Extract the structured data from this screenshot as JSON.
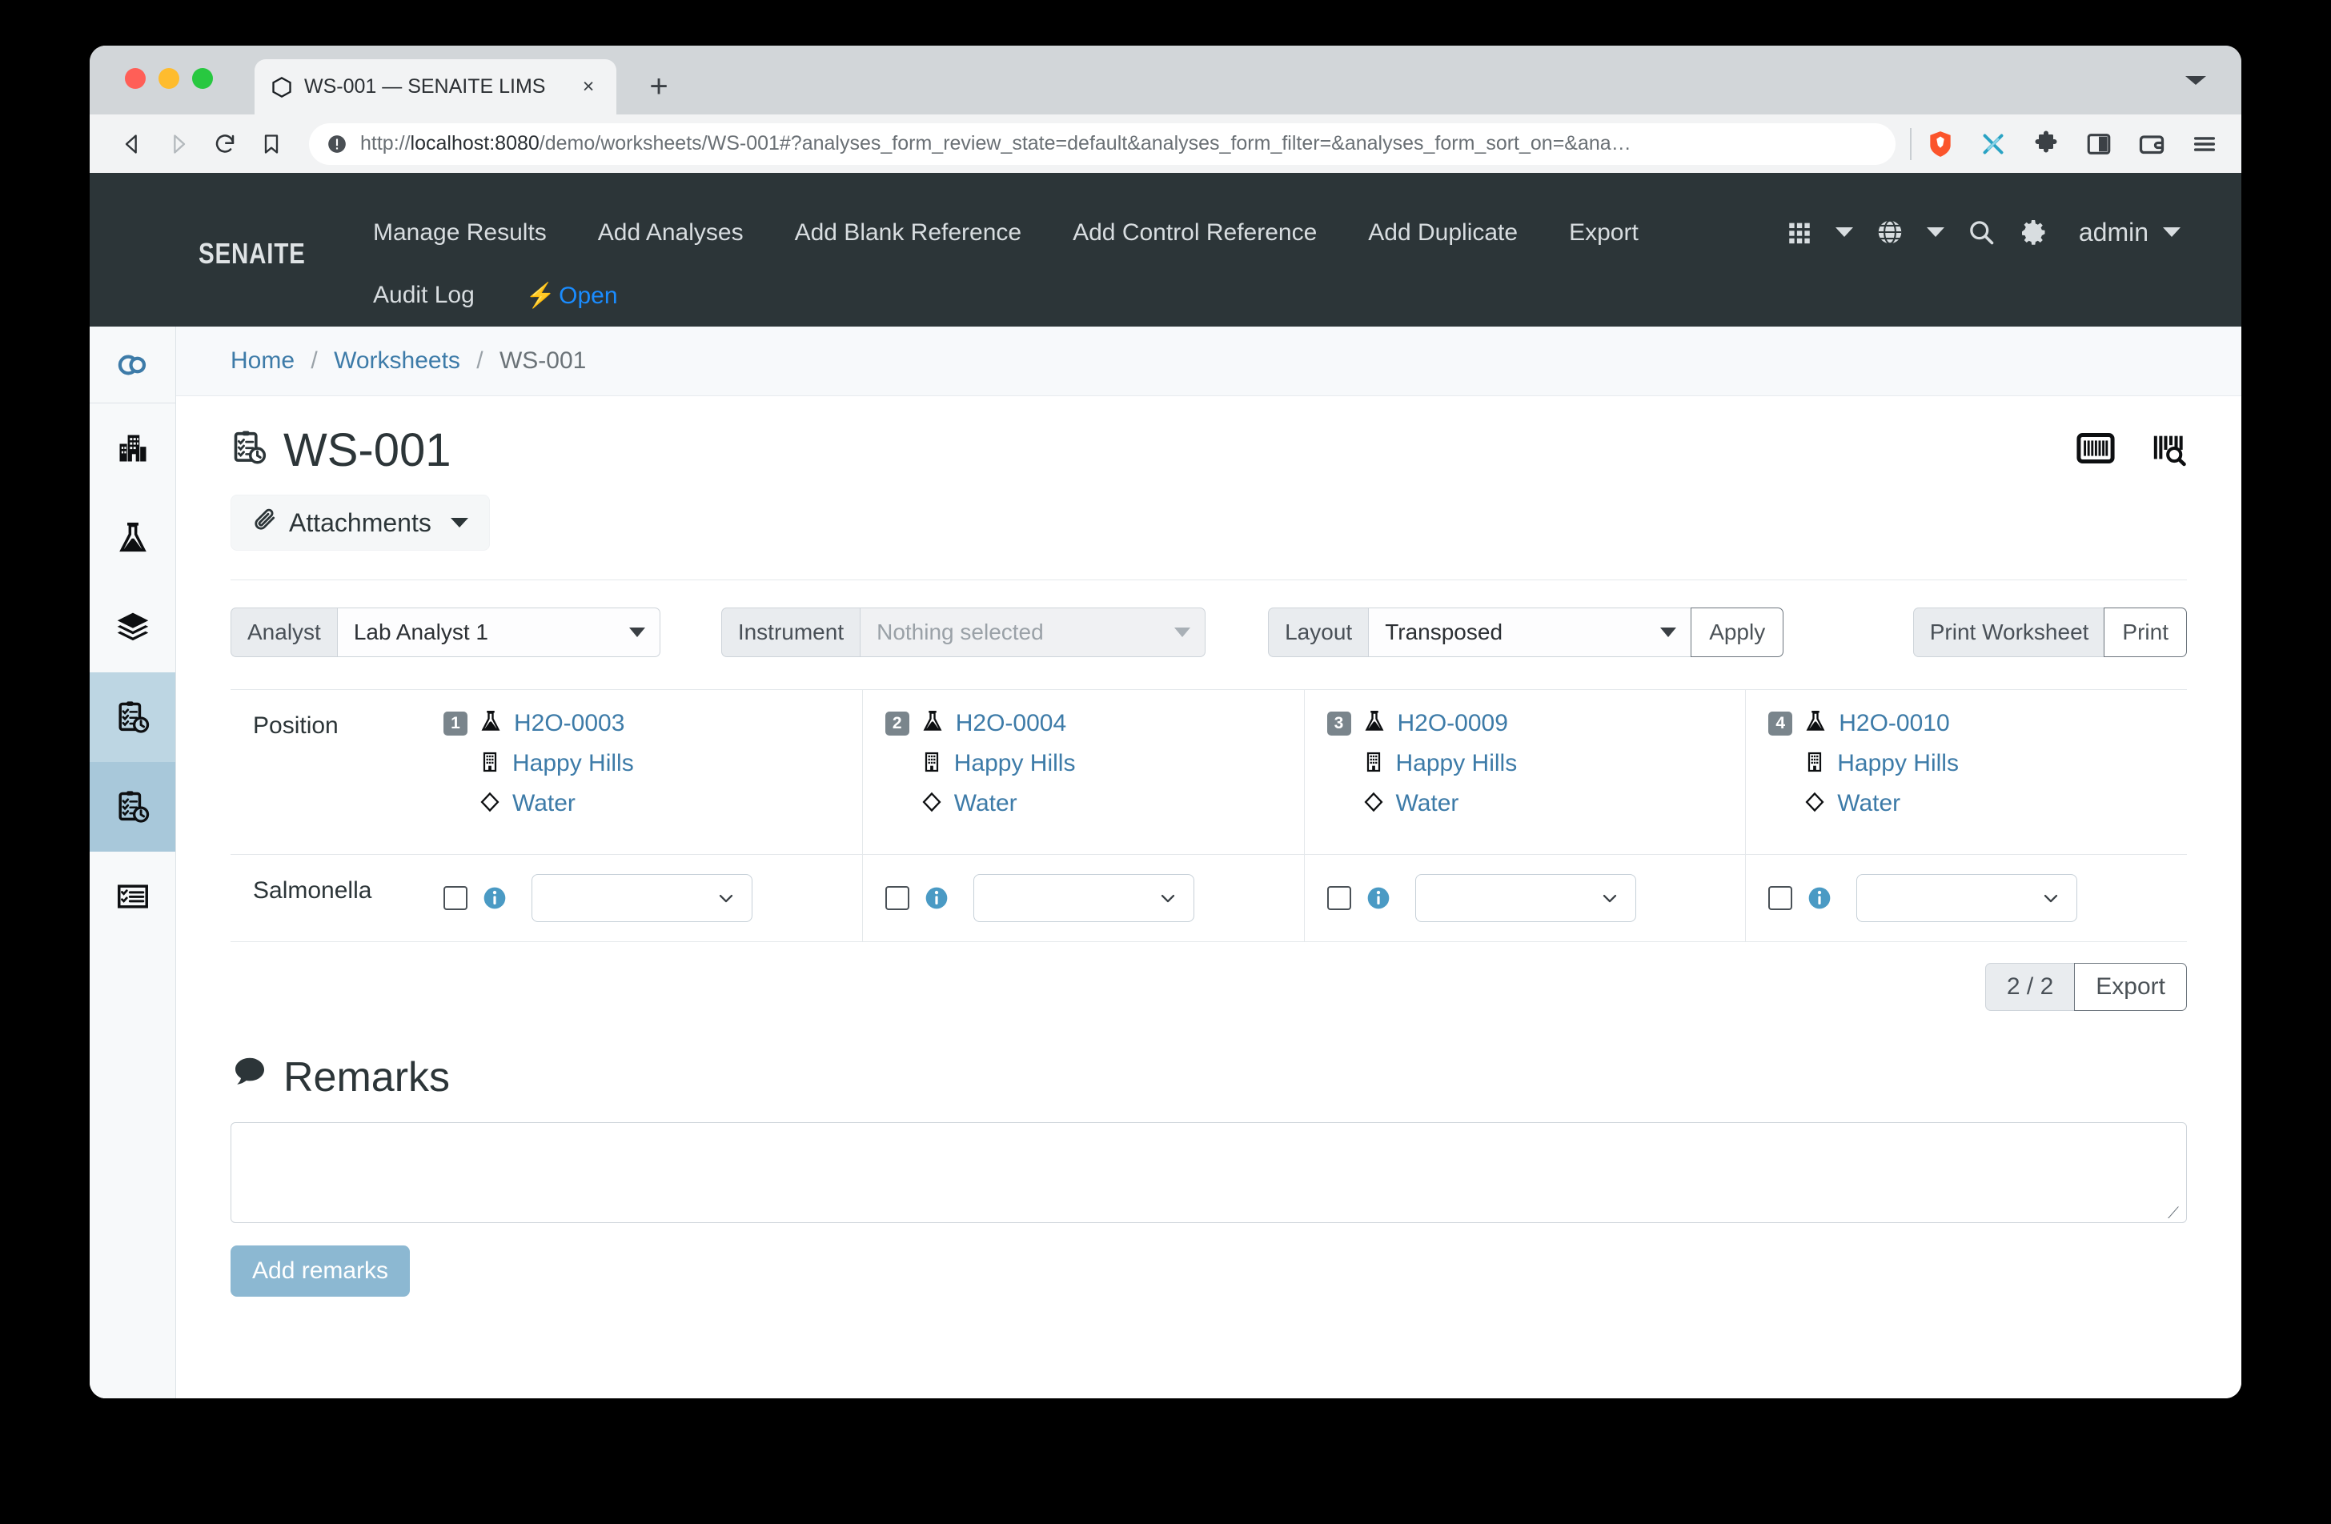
{
  "browser": {
    "tab_title": "WS-001 — SENAITE LIMS",
    "tab_favicon": "hexagon-icon",
    "close_tab": "×",
    "new_tab": "+",
    "url_prefix": "http://",
    "url_host": "localhost:8080",
    "url_rest": "/demo/worksheets/WS-001#?analyses_form_review_state=default&analyses_form_filter=&analyses_form_sort_on=&ana…",
    "back": "back-icon",
    "forward": "forward-icon",
    "reload": "reload-icon",
    "bookmark": "bookmark-icon",
    "security": "info-shield-icon",
    "toolbar_icons": [
      "brave-lion-icon",
      "braveshields-icon",
      "extensions-puzzle-icon",
      "sidebar-panel-icon",
      "wallet-icon",
      "menu-hamburger-icon"
    ]
  },
  "navbar": {
    "brand": "SENAITE",
    "links": [
      {
        "label": "Manage Results",
        "accent": false
      },
      {
        "label": "Add Analyses",
        "accent": false
      },
      {
        "label": "Add Blank Reference",
        "accent": false
      },
      {
        "label": "Add Control Reference",
        "accent": false
      },
      {
        "label": "Add Duplicate",
        "accent": false
      },
      {
        "label": "Export",
        "accent": false
      },
      {
        "label": "Audit Log",
        "accent": false
      },
      {
        "label": "Open",
        "accent": true
      }
    ],
    "user": "admin",
    "accent_color": "#1a8cff",
    "background": "#2c3538"
  },
  "sidebar": {
    "items": [
      {
        "name": "sidebar-toggle",
        "icon": "toggle-switch-icon",
        "state": "toggle"
      },
      {
        "name": "sidebar-item-clients",
        "icon": "building-icon",
        "state": "normal"
      },
      {
        "name": "sidebar-item-samples",
        "icon": "flask-icon",
        "state": "normal"
      },
      {
        "name": "sidebar-item-batches",
        "icon": "layers-icon",
        "state": "normal"
      },
      {
        "name": "sidebar-item-worksheets",
        "icon": "clipboard-clock-icon",
        "state": "selected-light"
      },
      {
        "name": "sidebar-item-worksheet-current",
        "icon": "clipboard-clock-icon",
        "state": "selected-dark"
      },
      {
        "name": "sidebar-item-methods",
        "icon": "checklist-icon",
        "state": "normal"
      }
    ]
  },
  "breadcrumb": {
    "home": "Home",
    "worksheets": "Worksheets",
    "current": "WS-001",
    "separator": "/"
  },
  "page": {
    "title": "WS-001",
    "title_icon": "clipboard-clock-icon",
    "attachments_label": "Attachments",
    "attachments_icon": "paperclip-icon",
    "barcode_icon": "barcode-icon",
    "barcode_scan_icon": "barcode-search-icon"
  },
  "filters": {
    "analyst_label": "Analyst",
    "analyst_value": "Lab Analyst 1",
    "instrument_label": "Instrument",
    "instrument_placeholder": "Nothing selected",
    "layout_label": "Layout",
    "layout_value": "Transposed",
    "apply_label": "Apply",
    "print_worksheet_label": "Print Worksheet",
    "print_label": "Print"
  },
  "worksheet": {
    "position_row_label": "Position",
    "positions": [
      {
        "pos": "1",
        "sample": "H2O-0003",
        "client": "Happy Hills",
        "sample_type": "Water"
      },
      {
        "pos": "2",
        "sample": "H2O-0004",
        "client": "Happy Hills",
        "sample_type": "Water"
      },
      {
        "pos": "3",
        "sample": "H2O-0009",
        "client": "Happy Hills",
        "sample_type": "Water"
      },
      {
        "pos": "4",
        "sample": "H2O-0010",
        "client": "Happy Hills",
        "sample_type": "Water"
      }
    ],
    "analyses": [
      {
        "name": "Salmonella",
        "cells": [
          {
            "checked": false,
            "result": ""
          },
          {
            "checked": false,
            "result": ""
          },
          {
            "checked": false,
            "result": ""
          },
          {
            "checked": false,
            "result": ""
          }
        ]
      }
    ],
    "pager_count": "2 / 2",
    "export_label": "Export"
  },
  "remarks": {
    "heading": "Remarks",
    "heading_icon": "comment-icon",
    "value": "",
    "add_button": "Add remarks",
    "button_color": "#8cb8d2"
  }
}
